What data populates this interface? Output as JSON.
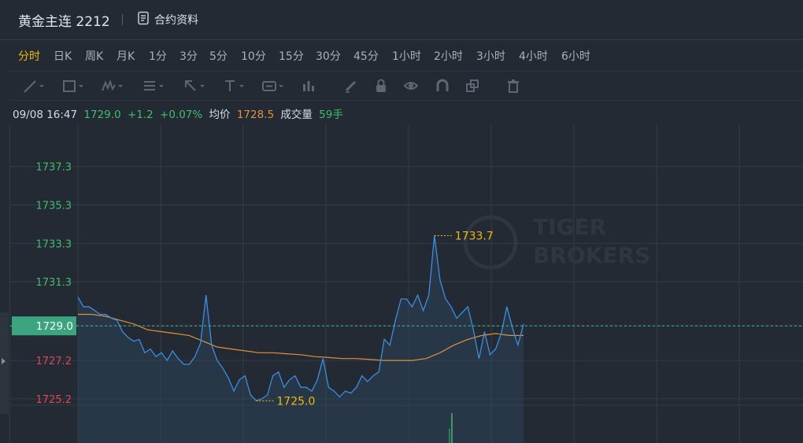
{
  "header": {
    "title": "黄金主连 2212",
    "info_label": "合约资料"
  },
  "timeframes": [
    {
      "label": "分时",
      "active": true
    },
    {
      "label": "日K"
    },
    {
      "label": "周K"
    },
    {
      "label": "月K"
    },
    {
      "label": "1分"
    },
    {
      "label": "3分"
    },
    {
      "label": "5分"
    },
    {
      "label": "10分"
    },
    {
      "label": "15分"
    },
    {
      "label": "30分"
    },
    {
      "label": "45分"
    },
    {
      "label": "1小时"
    },
    {
      "label": "2小时"
    },
    {
      "label": "3小时"
    },
    {
      "label": "4小时"
    },
    {
      "label": "6小时"
    }
  ],
  "toolbar": {
    "tools": [
      "line-tool-icon",
      "rectangle-tool-icon",
      "pattern-tool-icon",
      "fibonacci-tool-icon",
      "arrow-tool-icon",
      "text-tool-icon",
      "price-label-tool-icon",
      "measure-tool-icon",
      "pen-icon",
      "lock-icon",
      "eye-icon",
      "magnet-icon",
      "copy-icon",
      "trash-icon"
    ]
  },
  "quote": {
    "datetime": "09/08 16:47",
    "price": "1729.0",
    "change": "+1.2",
    "change_pct": "+0.07%",
    "avg_label": "均价",
    "avg_value": "1728.5",
    "volume_label": "成交量",
    "volume_value": "59手"
  },
  "colors": {
    "price_line": "#3a8fe0",
    "avg_line": "#e2913a",
    "up": "#3dbf6a",
    "down": "#e0464e",
    "highlight": "#f0b90b",
    "current_price_line": "#3fbf9f"
  },
  "watermark": "TIGER BROKERS",
  "chart_data": {
    "type": "line",
    "yticks": [
      "1737.3",
      "1735.3",
      "1733.3",
      "1731.3",
      "1729.0",
      "1727.2",
      "1725.2"
    ],
    "ylim": [
      1722.9,
      1739.5
    ],
    "current_price": 1729.0,
    "current_price_label": "1729.0",
    "max_label": "1733.7",
    "min_label": "1725.0",
    "series": [
      {
        "values": [
          1730.5,
          1730.0,
          1730.0,
          1729.8,
          1729.6,
          1729.6,
          1729.4,
          1729.3,
          1728.7,
          1728.4,
          1728.2,
          1728.3,
          1727.6,
          1727.8,
          1727.4,
          1727.6,
          1727.2,
          1727.7,
          1727.3,
          1727.0,
          1727.0,
          1727.4,
          1728.1,
          1730.6,
          1728.0,
          1727.2,
          1726.8,
          1726.3,
          1725.6,
          1726.2,
          1726.4,
          1725.4,
          1725.1,
          1725.2,
          1725.4,
          1726.4,
          1726.6,
          1725.8,
          1726.2,
          1726.4,
          1725.8,
          1725.8,
          1725.6,
          1726.2,
          1727.3,
          1725.8,
          1725.6,
          1725.3,
          1725.6,
          1725.5,
          1725.8,
          1726.4,
          1726.1,
          1726.4,
          1726.6,
          1728.3,
          1728.0,
          1729.3,
          1730.4,
          1730.4,
          1730.0,
          1730.6,
          1729.8,
          1730.6,
          1733.7,
          1731.4,
          1730.4,
          1730.0,
          1729.4,
          1729.7,
          1730.0,
          1728.8,
          1727.3,
          1728.7,
          1727.5,
          1727.8,
          1728.6,
          1730.0,
          1728.9,
          1728.0,
          1729.1
        ]
      },
      {
        "values": [
          1729.6,
          1729.6,
          1729.5,
          1729.3,
          1729.1,
          1728.8,
          1728.7,
          1728.6,
          1728.5,
          1728.2,
          1727.9,
          1727.8,
          1727.7,
          1727.6,
          1727.6,
          1727.55,
          1727.5,
          1727.4,
          1727.35,
          1727.3,
          1727.3,
          1727.25,
          1727.2,
          1727.2,
          1727.2,
          1727.3,
          1727.6,
          1728.0,
          1728.3,
          1728.5,
          1728.6,
          1728.5,
          1728.5
        ]
      }
    ]
  }
}
